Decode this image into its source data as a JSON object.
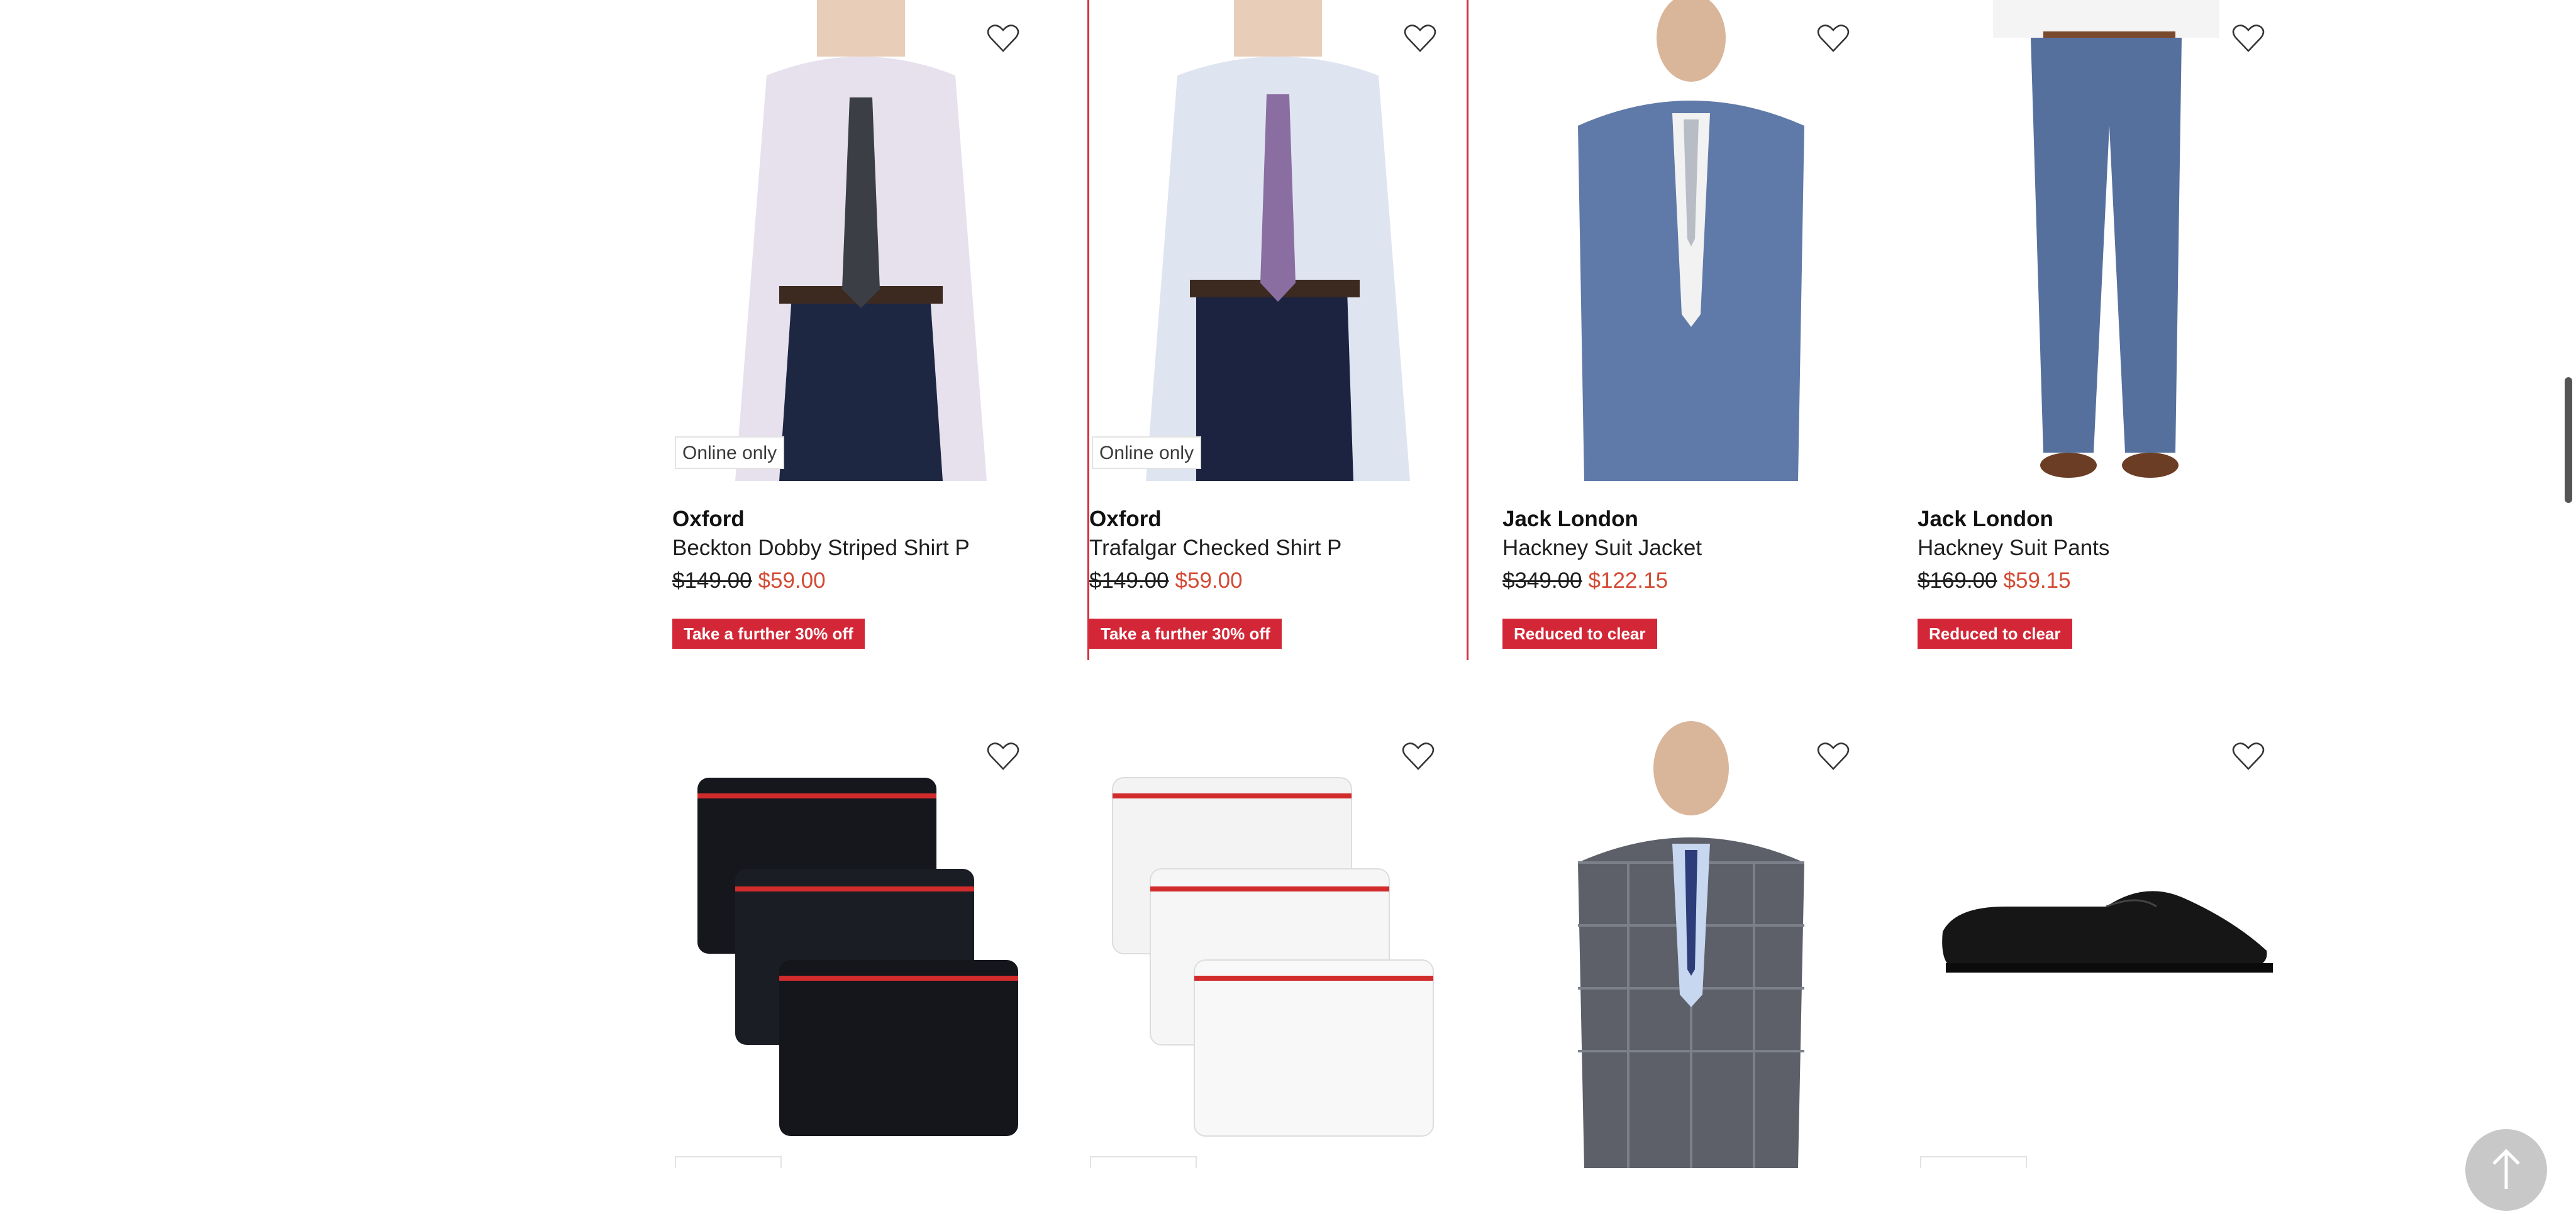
{
  "colors": {
    "accent": "#d32737",
    "sale_price": "#d44a33",
    "selected_outline": "#d0313f"
  },
  "products_row1": [
    {
      "tag": "Online only",
      "brand": "Oxford",
      "name": "Beckton Dobby Striped Shirt P",
      "was": "$149.00",
      "now": "$59.00",
      "badge": "Take a further 30% off",
      "image": "shirt-lilac-dark-tie"
    },
    {
      "tag": "Online only",
      "brand": "Oxford",
      "name": "Trafalgar Checked Shirt P",
      "was": "$149.00",
      "now": "$59.00",
      "badge": "Take a further 30% off",
      "image": "shirt-blue-check-purple-tie"
    },
    {
      "tag": "",
      "brand": "Jack London",
      "name": "Hackney Suit Jacket",
      "was": "$349.00",
      "now": "$122.15",
      "badge": "Reduced to clear",
      "image": "blue-suit-jacket"
    },
    {
      "tag": "",
      "brand": "Jack London",
      "name": "Hackney Suit Pants",
      "was": "$169.00",
      "now": "$59.15",
      "badge": "Reduced to clear",
      "image": "blue-suit-pants"
    }
  ],
  "products_row2": [
    {
      "image": "black-trunks-3-pack",
      "tag_visible": true
    },
    {
      "image": "white-trunks-3-pack",
      "tag_visible": true
    },
    {
      "image": "grey-check-suit",
      "tag_visible": false
    },
    {
      "image": "black-oxford-shoe",
      "tag_visible": true
    }
  ],
  "icons": {
    "wishlist": "heart-outline-icon",
    "back_to_top": "arrow-up-icon"
  }
}
